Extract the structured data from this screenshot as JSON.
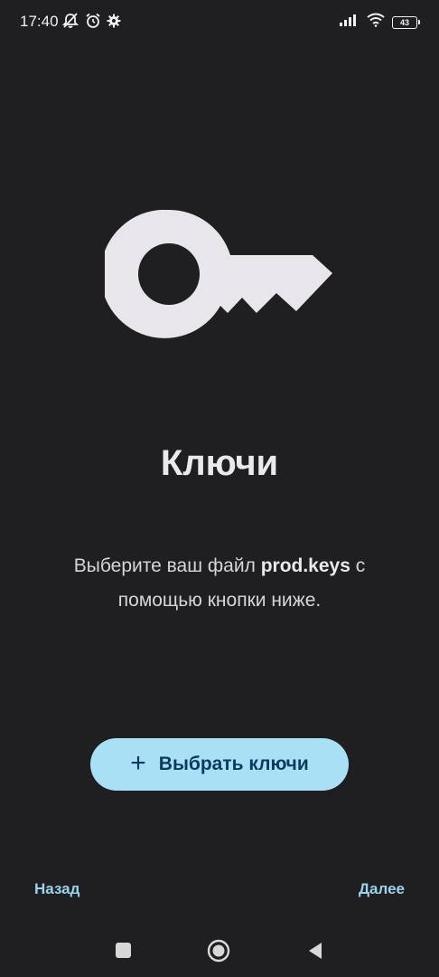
{
  "status_bar": {
    "time": "17:40",
    "battery_level": "43",
    "left_icons": [
      "muted-bell-icon",
      "alarm-clock-icon",
      "gear-icon"
    ],
    "right_icons": [
      "signal-bars-icon",
      "wifi-icon",
      "battery-icon"
    ]
  },
  "hero": {
    "icon": "key-icon",
    "icon_color": "#e8e6ea"
  },
  "title": "Ключи",
  "description": {
    "before": "Выберите ваш файл ",
    "filename": "prod.keys",
    "after": " с помощью кнопки ниже."
  },
  "select_button": {
    "icon": "plus-icon",
    "label": "Выбрать ключи",
    "background": "#a9e0f5",
    "text_color": "#0a3a5e"
  },
  "footer": {
    "back_label": "Назад",
    "next_label": "Далее",
    "link_color": "#9bd3ea"
  },
  "system_nav": {
    "buttons": [
      "recent-apps-icon",
      "home-icon",
      "back-icon"
    ]
  },
  "colors": {
    "background": "#1f1e21",
    "text": "#ebe9ec"
  }
}
